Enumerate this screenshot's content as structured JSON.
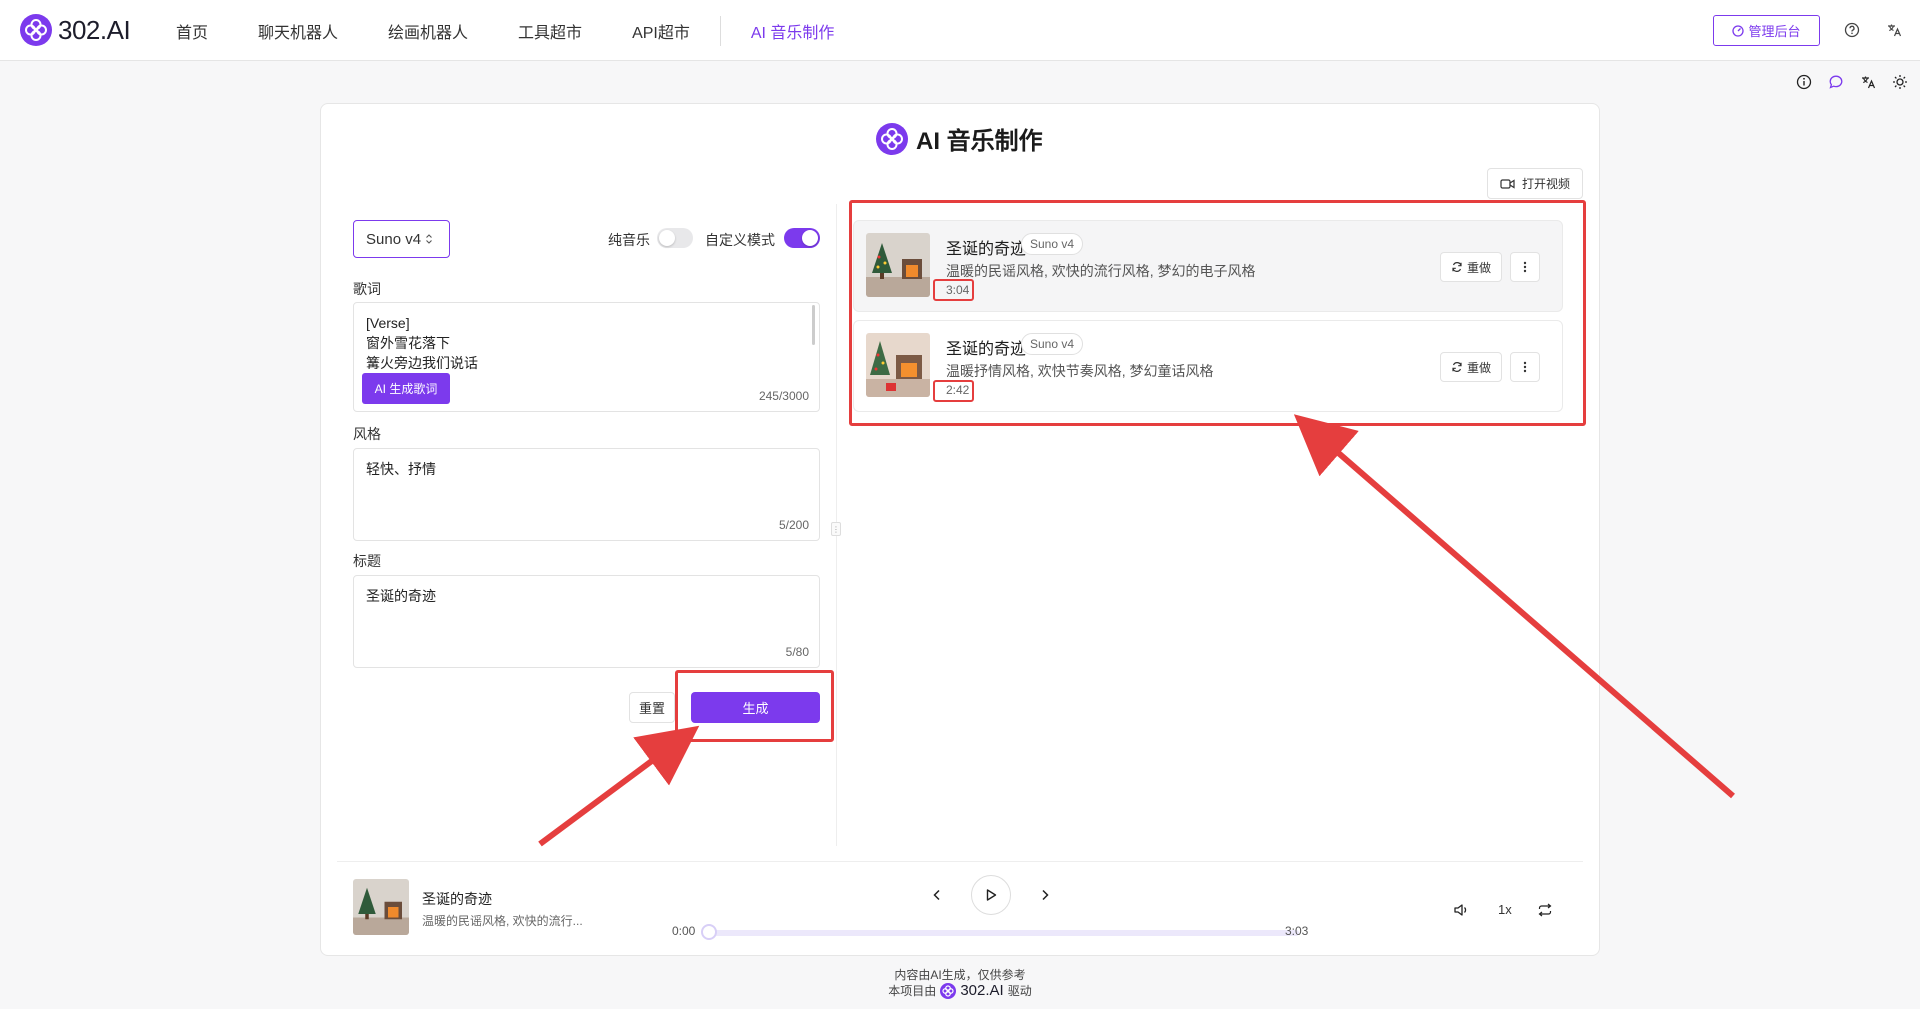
{
  "nav": {
    "brand": "302.AI",
    "items": [
      "首页",
      "聊天机器人",
      "绘画机器人",
      "工具超市",
      "API超市"
    ],
    "active": "AI 音乐制作",
    "admin_button": "管理后台"
  },
  "page": {
    "title": "AI 音乐制作",
    "open_video": "打开视频"
  },
  "form": {
    "model": "Suno v4",
    "instrumental_label": "纯音乐",
    "instrumental_on": false,
    "custom_label": "自定义模式",
    "custom_on": true,
    "lyrics_label": "歌词",
    "lyrics_text": "[Verse]\n窗外雪花落下\n篝火旁边我们说话",
    "lyrics_count": "245/3000",
    "ai_lyrics_button": "AI 生成歌词",
    "style_label": "风格",
    "style_text": "轻快、抒情",
    "style_count": "5/200",
    "title_label": "标题",
    "title_text": "圣诞的奇迹",
    "title_count": "5/80",
    "reset_button": "重置",
    "generate_button": "生成"
  },
  "songs": [
    {
      "title": "圣诞的奇迹",
      "model": "Suno v4",
      "desc": "温暖的民谣风格, 欢快的流行风格, 梦幻的电子风格",
      "duration": "3:04",
      "redo": "重做"
    },
    {
      "title": "圣诞的奇迹",
      "model": "Suno v4",
      "desc": "温暖抒情风格, 欢快节奏风格, 梦幻童话风格",
      "duration": "2:42",
      "redo": "重做"
    }
  ],
  "player": {
    "title": "圣诞的奇迹",
    "desc": "温暖的民谣风格, 欢快的流行...",
    "current": "0:00",
    "total": "3:03",
    "progress": 0,
    "speed": "1x"
  },
  "footer": {
    "line1": "内容由AI生成，仅供参考",
    "line2_prefix": "本项目由",
    "line2_brand": "302.AI",
    "line2_suffix": "驱动"
  },
  "colors": {
    "accent": "#7c3aed",
    "highlight": "#e53e3e"
  }
}
